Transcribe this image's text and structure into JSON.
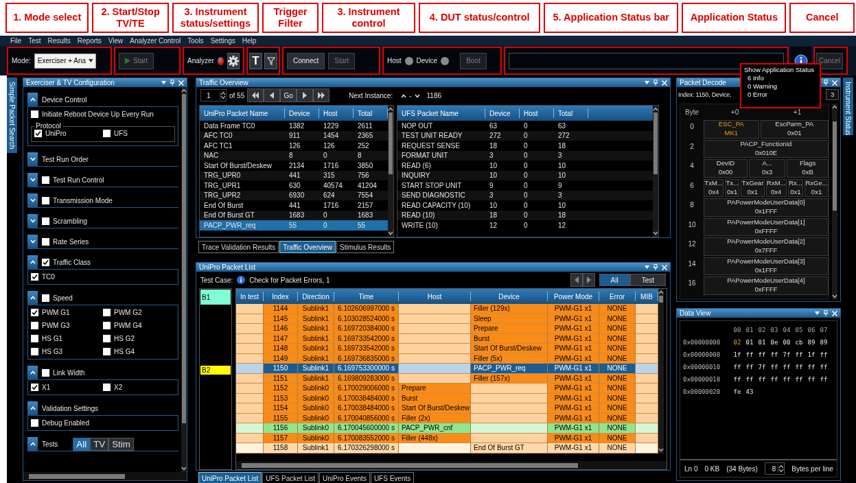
{
  "annotations": [
    "1. Mode select",
    "2. Start/Stop TV/TE",
    "3. Instrument status/settings",
    "Trigger Filter",
    "3. Instrument control",
    "4. DUT status/control",
    "5. Application Status bar",
    "Application Status",
    "Cancel"
  ],
  "menu": [
    "File",
    "Test",
    "Results",
    "Reports",
    "View",
    "Analyzer Control",
    "Tools",
    "Settings",
    "Help"
  ],
  "toolbar": {
    "mode_label": "Mode:",
    "mode_value": "Exerciser + Ana",
    "start_button": {
      "label": "Start",
      "disabled": true
    },
    "analyzer_label": "Analyzer",
    "trigger_label": "T",
    "connect_button": {
      "label": "Connect",
      "disabled": false
    },
    "instrument_start_button": {
      "label": "Start",
      "disabled": true
    },
    "host_label": "Host",
    "device_label": "Device",
    "boot_button": {
      "label": "Boot",
      "disabled": true
    },
    "cancel_button": {
      "label": "Cancel",
      "disabled": true
    }
  },
  "app_status": {
    "title": "Show Application Status",
    "counts": [
      "6 Info",
      "0 Warning",
      "0 Error"
    ]
  },
  "left_side_tab": "Simple Packet Search",
  "right_side_tab": "Instrument Status",
  "config": {
    "title": "Exerciser & TV Configuration",
    "sections": [
      {
        "title": "Device Control",
        "expanded": true,
        "items": [
          {
            "label": "Initiate Reboot Device Up Every Run",
            "checked": false
          }
        ],
        "group": {
          "title": "Protocol",
          "items": [
            {
              "label": "UniPro",
              "checked": true
            },
            {
              "label": "UFS",
              "checked": false
            }
          ]
        }
      },
      {
        "title": "Test Run Order",
        "expanded": false
      },
      {
        "title": "Test Run Control",
        "expanded": false,
        "checked": false
      },
      {
        "title": "Transmission Mode",
        "expanded": false,
        "checked": false
      },
      {
        "title": "Scrambling",
        "expanded": false,
        "checked": false
      },
      {
        "title": "Rate Series",
        "expanded": false,
        "checked": false
      },
      {
        "title": "Traffic Class",
        "expanded": true,
        "checked": true,
        "items": [
          {
            "label": "TC0",
            "checked": true
          }
        ]
      },
      {
        "title": "Speed",
        "expanded": true,
        "checked": false,
        "items": [
          {
            "label": "PWM G1",
            "checked": true
          },
          {
            "label": "PWM G2",
            "checked": false
          },
          {
            "label": "PWM G3",
            "checked": false
          },
          {
            "label": "PWM G4",
            "checked": false
          },
          {
            "label": "HS G1",
            "checked": false
          },
          {
            "label": "HS G2",
            "checked": false
          },
          {
            "label": "HS G3",
            "checked": false
          },
          {
            "label": "HS G4",
            "checked": false
          }
        ]
      },
      {
        "title": "Link Width",
        "expanded": true,
        "checked": false,
        "items": [
          {
            "label": "X1",
            "checked": true
          },
          {
            "label": "X2",
            "checked": false
          }
        ]
      },
      {
        "title": "Validation Settings",
        "expanded": true,
        "items": [
          {
            "label": "Debug Enabled",
            "checked": false
          }
        ]
      },
      {
        "title": "Tests",
        "expanded": true,
        "filters": [
          {
            "label": "All",
            "selected": true
          },
          {
            "label": "TV",
            "selected": false
          },
          {
            "label": "Stim",
            "selected": false
          }
        ]
      }
    ]
  },
  "traffic_overview": {
    "title": "Traffic Overview",
    "page": "1",
    "page_count": "of 55",
    "go": "Go",
    "next_instance_label": "Next Instance:",
    "next_instance_sep": "-",
    "next_instance_value": "1186",
    "unipro": {
      "columns": [
        "UniPro Packet Name",
        "Device",
        "Host",
        "Total"
      ],
      "rows": [
        {
          "cells": [
            "Data Frame TC0",
            "1382",
            "1229",
            "2611"
          ],
          "selected": false
        },
        {
          "cells": [
            "AFC TC0",
            "911",
            "1454",
            "2365"
          ],
          "selected": false
        },
        {
          "cells": [
            "AFC TC1",
            "126",
            "126",
            "252"
          ],
          "selected": false
        },
        {
          "cells": [
            "NAC",
            "8",
            "0",
            "8"
          ],
          "selected": false
        },
        {
          "cells": [
            "Start Of Burst/Deskew",
            "2134",
            "1716",
            "3850"
          ],
          "selected": false
        },
        {
          "cells": [
            "TRG_UPR0",
            "441",
            "315",
            "756"
          ],
          "selected": false
        },
        {
          "cells": [
            "TRG_UPR1",
            "630",
            "40574",
            "41204"
          ],
          "selected": false
        },
        {
          "cells": [
            "TRG_UPR2",
            "6930",
            "624",
            "7554"
          ],
          "selected": false
        },
        {
          "cells": [
            "End Of Burst",
            "441",
            "1716",
            "2157"
          ],
          "selected": false
        },
        {
          "cells": [
            "End Of Burst GT",
            "1683",
            "0",
            "1683"
          ],
          "selected": false
        },
        {
          "cells": [
            "PACP_PWR_req",
            "55",
            "0",
            "55"
          ],
          "selected": true
        }
      ]
    },
    "ufs": {
      "columns": [
        "UFS Packet Name",
        "Device",
        "Host",
        "Total"
      ],
      "rows": [
        {
          "cells": [
            "NOP OUT",
            "63",
            "0",
            "63"
          ],
          "selected": false
        },
        {
          "cells": [
            "TEST UNIT READY",
            "272",
            "0",
            "272"
          ],
          "selected": false
        },
        {
          "cells": [
            "REQUEST SENSE",
            "18",
            "0",
            "18"
          ],
          "selected": false
        },
        {
          "cells": [
            "FORMAT UNIT",
            "3",
            "0",
            "3"
          ],
          "selected": false
        },
        {
          "cells": [
            "READ (6)",
            "10",
            "0",
            "10"
          ],
          "selected": false
        },
        {
          "cells": [
            "INQUIRY",
            "10",
            "0",
            "10"
          ],
          "selected": false
        },
        {
          "cells": [
            "START STOP UNIT",
            "9",
            "0",
            "9"
          ],
          "selected": false
        },
        {
          "cells": [
            "SEND DIAGNOSTIC",
            "3",
            "0",
            "3"
          ],
          "selected": false
        },
        {
          "cells": [
            "READ CAPACITY (10)",
            "10",
            "0",
            "10"
          ],
          "selected": false
        },
        {
          "cells": [
            "READ (10)",
            "18",
            "0",
            "18"
          ],
          "selected": false
        },
        {
          "cells": [
            "WRITE (10)",
            "12",
            "0",
            "12"
          ],
          "selected": false
        }
      ]
    }
  },
  "traffic_tabs": [
    {
      "label": "Trace Validation Results",
      "selected": false
    },
    {
      "label": "Traffic Overview",
      "selected": true
    },
    {
      "label": "Stimulus Results",
      "selected": false
    }
  ],
  "packet_list": {
    "title": "UniPro Packet List",
    "test_case_label": "Test Case:",
    "test_case": "Check for Packet Errors, 1",
    "filters": [
      {
        "label": "All",
        "selected": true
      },
      {
        "label": "Test",
        "selected": false
      }
    ],
    "top_bookmark": {
      "label": "B1",
      "color": "#80ffd4"
    },
    "columns": [
      "In test",
      "Index",
      "Direction",
      "Time",
      "Host",
      "Device",
      "Power Mode",
      "Error",
      "MIB"
    ],
    "rows": [
      {
        "kind": "normal",
        "index": "1144",
        "direction": "Sublink1",
        "time": "6.102606997000 s",
        "device": "Filler (129x)",
        "power_mode": "PWM-G1 x1",
        "error": "NONE"
      },
      {
        "kind": "normal",
        "index": "1145",
        "direction": "Sublink1",
        "time": "6.103028524000 s",
        "device": "Sleep",
        "power_mode": "PWM-G1 x1",
        "error": "NONE"
      },
      {
        "kind": "normal",
        "index": "1146",
        "direction": "Sublink1",
        "time": "6.169720384000 s",
        "device": "Prepare",
        "power_mode": "PWM-G1 x1",
        "error": "NONE"
      },
      {
        "kind": "normal",
        "index": "1147",
        "direction": "Sublink1",
        "time": "6.169733542000 s",
        "device": "Burst",
        "power_mode": "PWM-G1 x1",
        "error": "NONE"
      },
      {
        "kind": "normal",
        "index": "1148",
        "direction": "Sublink1",
        "time": "6.169733542000 s",
        "device": "Start Of Burst/Deskew",
        "power_mode": "PWM-G1 x1",
        "error": "NONE"
      },
      {
        "kind": "normal",
        "index": "1149",
        "direction": "Sublink1",
        "time": "6.169736835000 s",
        "device": "Filler (5x)",
        "power_mode": "PWM-G1 x1",
        "error": "NONE"
      },
      {
        "kind": "selected",
        "index": "1150",
        "direction": "Sublink1",
        "time": "6.169753300000 s",
        "device": "PACP_PWR_req",
        "power_mode": "PWM-G1 x1",
        "error": "NONE",
        "bookmark": {
          "label": "B2",
          "color": "#ffff00"
        }
      },
      {
        "kind": "normal",
        "index": "1151",
        "direction": "Sublink1",
        "time": "6.169809283000 s",
        "device": "Filler (157x)",
        "power_mode": "PWM-G1 x1",
        "error": "NONE"
      },
      {
        "kind": "normal",
        "index": "1152",
        "direction": "Sublink0",
        "time": "6.170029006000 s",
        "host": "Prepare",
        "power_mode": "PWM-G1 x1",
        "error": "NONE"
      },
      {
        "kind": "normal",
        "index": "1153",
        "direction": "Sublink0",
        "time": "6.170038484000 s",
        "host": "Burst",
        "power_mode": "PWM-G1 x1",
        "error": "NONE"
      },
      {
        "kind": "normal",
        "index": "1154",
        "direction": "Sublink0",
        "time": "6.170038484000 s",
        "host": "Start Of Burst/Deskew",
        "power_mode": "PWM-G1 x1",
        "error": "NONE"
      },
      {
        "kind": "normal",
        "index": "1155",
        "direction": "Sublink0",
        "time": "6.170040856000 s",
        "host": "Filler (2x)",
        "power_mode": "PWM-G1 x1",
        "error": "NONE"
      },
      {
        "kind": "green",
        "index": "1156",
        "direction": "Sublink0",
        "time": "6.170045600000 s",
        "host": "PACP_PWR_cnf",
        "power_mode": "PWM-G1 x1",
        "error": "NONE"
      },
      {
        "kind": "normal",
        "index": "1157",
        "direction": "Sublink0",
        "time": "6.170083552000 s",
        "host": "Filler (448x)",
        "power_mode": "PWM-G1 x1",
        "error": "NONE"
      },
      {
        "kind": "light",
        "index": "1158",
        "direction": "Sublink1",
        "time": "6.170326298000 s",
        "device": "End Of Burst GT",
        "power_mode": "PWM-G1 x1",
        "error": "NONE"
      }
    ]
  },
  "packet_tabs": [
    {
      "label": "UniPro Packet List",
      "selected": true
    },
    {
      "label": "UFS Packet List",
      "selected": false
    },
    {
      "label": "UniPro Events",
      "selected": false
    },
    {
      "label": "UFS Events",
      "selected": false
    }
  ],
  "packet_decode": {
    "title": "Packet Decode",
    "summary": "Index: 1150, Device,",
    "field_value": "3",
    "header": [
      "Byte",
      "+0",
      "+1"
    ],
    "rows": [
      {
        "byte": "0",
        "fields": [
          {
            "name": "ESC_PA",
            "value": "MK1",
            "highlight": true
          },
          {
            "name": "EscParm_PA",
            "value": "0x01",
            "highlight": false
          }
        ]
      },
      {
        "byte": "2",
        "fields": [
          {
            "name": "PACP_FunctionId",
            "value": "0x010E",
            "highlight": false
          }
        ]
      },
      {
        "byte": "4",
        "fields": [
          {
            "name": "DevID",
            "value": "0x00",
            "highlight": false
          },
          {
            "name": "A...",
            "value": "0x3",
            "highlight": false
          },
          {
            "name": "Flags",
            "value": "0xB",
            "highlight": false
          }
        ]
      },
      {
        "byte": "6",
        "fields": [
          {
            "name": "TxM...",
            "value": "0x4",
            "highlight": false
          },
          {
            "name": "Tx...",
            "value": "0x1",
            "highlight": false
          },
          {
            "name": "TxGear",
            "value": "0x1",
            "highlight": false
          },
          {
            "name": "RxM...",
            "value": "0x4",
            "highlight": false
          },
          {
            "name": "Rx...",
            "value": "0x1",
            "highlight": false
          },
          {
            "name": "RxGe...",
            "value": "0x1",
            "highlight": false
          }
        ]
      },
      {
        "byte": "8",
        "fields": [
          {
            "name": "PAPowerModeUserData[0]",
            "value": "0x1FFF",
            "highlight": false
          }
        ]
      },
      {
        "byte": "10",
        "fields": [
          {
            "name": "PAPowerModeUserData[1]",
            "value": "0xFFFF",
            "highlight": false
          }
        ]
      },
      {
        "byte": "12",
        "fields": [
          {
            "name": "PAPowerModeUserData[2]",
            "value": "0x7FFF",
            "highlight": false
          }
        ]
      },
      {
        "byte": "14",
        "fields": [
          {
            "name": "PAPowerModeUserData[3]",
            "value": "0x1FFF",
            "highlight": false
          }
        ]
      },
      {
        "byte": "16",
        "fields": [
          {
            "name": "PAPowerModeUserData[4]",
            "value": "0xFFFF",
            "highlight": false
          }
        ]
      }
    ]
  },
  "data_view": {
    "title": "Data View",
    "columns": [
      "00",
      "01",
      "02",
      "03",
      "04",
      "05",
      "06",
      "07"
    ],
    "rows": [
      {
        "address": "0x00000000",
        "bytes": [
          {
            "value": "02",
            "selected": true
          },
          {
            "value": "01",
            "selected": false
          },
          {
            "value": "01",
            "selected": false
          },
          {
            "value": "0e",
            "selected": false
          },
          {
            "value": "00",
            "selected": false
          },
          {
            "value": "cb",
            "selected": false
          },
          {
            "value": "89",
            "selected": false
          },
          {
            "value": "89",
            "selected": false
          }
        ]
      },
      {
        "address": "0x00000008",
        "bytes": [
          {
            "value": "1f",
            "selected": false
          },
          {
            "value": "ff",
            "selected": false
          },
          {
            "value": "ff",
            "selected": false
          },
          {
            "value": "ff",
            "selected": false
          },
          {
            "value": "7f",
            "selected": false
          },
          {
            "value": "ff",
            "selected": false
          },
          {
            "value": "1f",
            "selected": false
          },
          {
            "value": "ff",
            "selected": false
          }
        ]
      },
      {
        "address": "0x00000010",
        "bytes": [
          {
            "value": "ff",
            "selected": false
          },
          {
            "value": "ff",
            "selected": false
          },
          {
            "value": "7f",
            "selected": false
          },
          {
            "value": "ff",
            "selected": false
          },
          {
            "value": "ff",
            "selected": false
          },
          {
            "value": "ff",
            "selected": false
          },
          {
            "value": "ff",
            "selected": false
          },
          {
            "value": "ff",
            "selected": false
          }
        ]
      },
      {
        "address": "0x00000018",
        "bytes": [
          {
            "value": "ff",
            "selected": false
          },
          {
            "value": "ff",
            "selected": false
          },
          {
            "value": "ff",
            "selected": false
          },
          {
            "value": "ff",
            "selected": false
          },
          {
            "value": "ff",
            "selected": false
          },
          {
            "value": "ff",
            "selected": false
          },
          {
            "value": "ff",
            "selected": false
          },
          {
            "value": "ff",
            "selected": false
          }
        ]
      },
      {
        "address": "0x00000020",
        "bytes": [
          {
            "value": "fe",
            "selected": false
          },
          {
            "value": "43",
            "selected": false
          }
        ]
      }
    ],
    "line": "Ln 0",
    "size": "0 KB",
    "byte_count": "(34 Bytes)",
    "bytes_per_line": "8",
    "bytes_per_line_label": "Bytes per line"
  }
}
